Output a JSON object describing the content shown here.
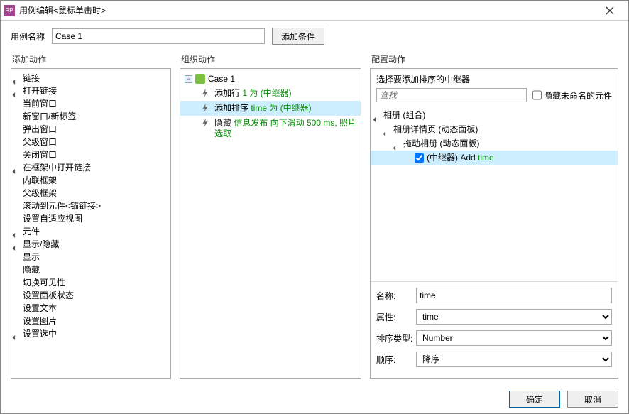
{
  "dialog": {
    "title": "用例编辑<鼠标单击时>"
  },
  "top": {
    "caseNameLabel": "用例名称",
    "caseNameValue": "Case 1",
    "addCondition": "添加条件"
  },
  "cols": {
    "c1": "添加动作",
    "c2": "组织动作",
    "c3": "配置动作"
  },
  "tree1": [
    {
      "l": "链接",
      "d": 0,
      "g": 1
    },
    {
      "l": "打开链接",
      "d": 1,
      "g": 1
    },
    {
      "l": "当前窗口",
      "d": 2
    },
    {
      "l": "新窗口/新标签",
      "d": 2
    },
    {
      "l": "弹出窗口",
      "d": 2
    },
    {
      "l": "父级窗口",
      "d": 2
    },
    {
      "l": "关闭窗口",
      "d": 1
    },
    {
      "l": "在框架中打开链接",
      "d": 1,
      "g": 1
    },
    {
      "l": "内联框架",
      "d": 2
    },
    {
      "l": "父级框架",
      "d": 2
    },
    {
      "l": "滚动到元件<锚链接>",
      "d": 1
    },
    {
      "l": "设置自适应视图",
      "d": 1
    },
    {
      "l": "元件",
      "d": 0,
      "g": 1
    },
    {
      "l": "显示/隐藏",
      "d": 1,
      "g": 1
    },
    {
      "l": "显示",
      "d": 2
    },
    {
      "l": "隐藏",
      "d": 2
    },
    {
      "l": "切换可见性",
      "d": 2
    },
    {
      "l": "设置面板状态",
      "d": 1
    },
    {
      "l": "设置文本",
      "d": 1
    },
    {
      "l": "设置图片",
      "d": 1
    },
    {
      "l": "设置选中",
      "d": 1,
      "g": 1
    }
  ],
  "org": {
    "caseLabel": "Case 1",
    "actions": [
      {
        "pre": "添加行 ",
        "g": "1 为 (中继器)",
        "sel": false
      },
      {
        "pre": "添加排序 ",
        "g": "time 为 (中继器)",
        "sel": true
      },
      {
        "pre": "隐藏 ",
        "g": "信息发布 向下滑动 500 ms, 照片选取",
        "sel": false
      }
    ]
  },
  "cfg": {
    "instruction": "选择要添加排序的中继器",
    "searchPlaceholder": "查找",
    "hideUnnamed": "隐藏未命名的元件",
    "tree": [
      {
        "l": "相册 (组合)",
        "d": 0,
        "g": 1
      },
      {
        "l": "相册详情页 (动态面板)",
        "d": 1,
        "g": 1
      },
      {
        "l": "拖动相册 (动态面板)",
        "d": 2,
        "g": 1
      },
      {
        "l": "(中继器) Add ",
        "g": "time",
        "d": 3,
        "cb": true,
        "checked": true,
        "sel": true
      }
    ],
    "fields": {
      "name": {
        "label": "名称:",
        "value": "time"
      },
      "property": {
        "label": "属性:",
        "value": "time"
      },
      "sortType": {
        "label": "排序类型:",
        "value": "Number"
      },
      "order": {
        "label": "顺序:",
        "value": "降序"
      }
    }
  },
  "footer": {
    "ok": "确定",
    "cancel": "取消"
  }
}
